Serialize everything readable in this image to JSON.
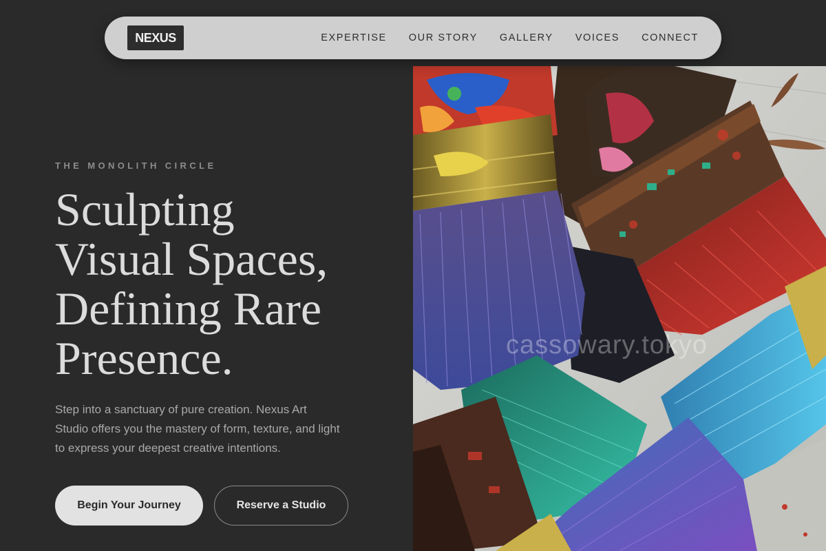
{
  "brand": {
    "logo_text": "NEXUS"
  },
  "nav": {
    "links": [
      {
        "label": "EXPERTISE"
      },
      {
        "label": "OUR STORY"
      },
      {
        "label": "GALLERY"
      },
      {
        "label": "VOICES"
      },
      {
        "label": "CONNECT"
      }
    ]
  },
  "hero": {
    "eyebrow": "THE MONOLITH CIRCLE",
    "headline_lines": [
      "Sculpting",
      "Visual Spaces,",
      "Defining Rare",
      "Presence."
    ],
    "body_lines": [
      "Step into a sanctuary of pure creation. Nexus Art",
      "Studio offers you the mastery of form, texture, and light",
      "to express your deepest creative intentions."
    ],
    "primary_button": "Begin Your Journey",
    "secondary_button": "Reserve a Studio",
    "image_watermark": "cassowary.tokyo"
  },
  "colors": {
    "background": "#2a2a2a",
    "nav_background": "#cfcfcf",
    "headline": "#dcdcdc",
    "body_text": "#a9a9a9",
    "eyebrow": "#8c8c8c",
    "primary_button_bg": "#e2e2e2"
  }
}
